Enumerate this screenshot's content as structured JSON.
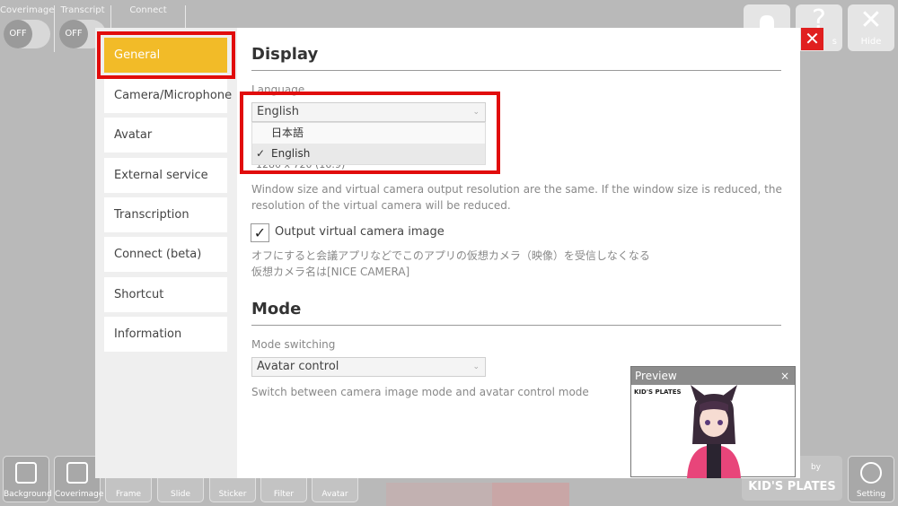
{
  "toggles": [
    {
      "label": "Coverimage",
      "state": "OFF"
    },
    {
      "label": "Transcript",
      "state": "OFF"
    },
    {
      "label": "Connect"
    }
  ],
  "top_buttons": {
    "help_glyph": "?",
    "hide_label": "Hide",
    "help_label": "s"
  },
  "bottom_toolbar": [
    {
      "label": "Background",
      "icon": "background-icon"
    },
    {
      "label": "Coverimage",
      "icon": "coverimage-icon"
    },
    {
      "label": "Frame",
      "icon": "frame-icon"
    },
    {
      "label": "Slide",
      "icon": "slide-icon"
    },
    {
      "label": "Sticker",
      "icon": "sticker-icon"
    },
    {
      "label": "Filter",
      "icon": "filter-icon"
    },
    {
      "label": "Avatar",
      "icon": "avatar-icon"
    }
  ],
  "brand": {
    "by": "by",
    "name": "KID'S PLATES"
  },
  "setting_label": "Setting",
  "sidebar": {
    "items": [
      {
        "label": "General",
        "active": true
      },
      {
        "label": "Camera/Microphone"
      },
      {
        "label": "Avatar"
      },
      {
        "label": "External service link"
      },
      {
        "label": "Transcription"
      },
      {
        "label": "Connect (beta)"
      },
      {
        "label": "Shortcut"
      },
      {
        "label": "Information"
      }
    ]
  },
  "display": {
    "title": "Display",
    "language_label": "Language",
    "language_value": "English",
    "language_options": [
      {
        "label": "日本語",
        "selected": false
      },
      {
        "label": "English",
        "selected": true
      }
    ],
    "window_size_value": "1280 x 720 (16:9)",
    "window_help_1": "Window size and virtual camera output resolution are the same. If the window size is reduced, the",
    "window_help_2": "resolution of the virtual camera will be reduced.",
    "output_checkbox_label": "Output virtual camera image",
    "output_checked": true,
    "output_help_1": "オフにすると会議アプリなどでこのアプリの仮想カメラ（映像）を受信しなくなる",
    "output_help_2": "仮想カメラ名は[NICE CAMERA]"
  },
  "mode": {
    "title": "Mode",
    "switch_label": "Mode switching",
    "switch_value": "Avatar control",
    "switch_help": "Switch between camera image mode and avatar control mode"
  },
  "preview": {
    "title": "Preview",
    "close": "×",
    "logo_text": "KID'S PLATES"
  },
  "colors": {
    "active_tab": "#f2bb28",
    "highlight": "#e10c0c",
    "close_button": "#e01f1f"
  }
}
